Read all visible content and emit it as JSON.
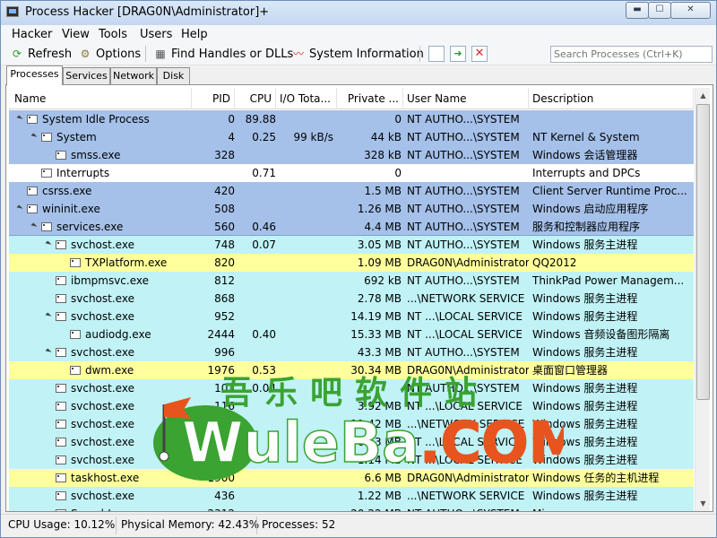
{
  "window": {
    "title": "Process Hacker [DRAG0N\\Administrator]+",
    "controls": {
      "minimize": "▬",
      "maximize": "☐",
      "close": "✕"
    }
  },
  "menu": [
    "Hacker",
    "View",
    "Tools",
    "Users",
    "Help"
  ],
  "toolbar": {
    "refresh": "Refresh",
    "options": "Options",
    "find_handles": "Find Handles or DLLs",
    "system_info": "System Information",
    "search_placeholder": "Search Processes (Ctrl+K)"
  },
  "tabs": [
    "Processes",
    "Services",
    "Network",
    "Disk"
  ],
  "columns": [
    "Name",
    "PID",
    "CPU",
    "I/O Tota...",
    "Private ...",
    "User Name",
    "Description"
  ],
  "rows": [
    {
      "name": "System Idle Process",
      "pid": "0",
      "cpu": "89.88",
      "io": "",
      "priv": "0",
      "user": "NT AUTHO...\\SYSTEM",
      "desc": "",
      "color": "#a5c1ea",
      "depth": 0,
      "exp": true
    },
    {
      "name": "System",
      "pid": "4",
      "cpu": "0.25",
      "io": "99 kB/s",
      "priv": "44 kB",
      "user": "NT AUTHO...\\SYSTEM",
      "desc": "NT Kernel & System",
      "color": "#a5c1ea",
      "depth": 1,
      "exp": true
    },
    {
      "name": "smss.exe",
      "pid": "328",
      "cpu": "",
      "io": "",
      "priv": "328 kB",
      "user": "NT AUTHO...\\SYSTEM",
      "desc": "Windows 会话管理器",
      "color": "#a5c1ea",
      "depth": 2,
      "exp": false
    },
    {
      "name": "Interrupts",
      "pid": "",
      "cpu": "0.71",
      "io": "",
      "priv": "0",
      "user": "",
      "desc": "Interrupts and DPCs",
      "color": "#ffffff",
      "depth": 1,
      "exp": false
    },
    {
      "name": "csrss.exe",
      "pid": "420",
      "cpu": "",
      "io": "",
      "priv": "1.5 MB",
      "user": "NT AUTHO...\\SYSTEM",
      "desc": "Client Server Runtime Proc...",
      "color": "#a5c1ea",
      "depth": 0,
      "exp": false
    },
    {
      "name": "wininit.exe",
      "pid": "508",
      "cpu": "",
      "io": "",
      "priv": "1.26 MB",
      "user": "NT AUTHO...\\SYSTEM",
      "desc": "Windows 启动应用程序",
      "color": "#a5c1ea",
      "depth": 0,
      "exp": true
    },
    {
      "name": "services.exe",
      "pid": "560",
      "cpu": "0.46",
      "io": "",
      "priv": "4.4 MB",
      "user": "NT AUTHO...\\SYSTEM",
      "desc": "服务和控制器应用程序",
      "color": "#a5c1ea",
      "depth": 1,
      "exp": true
    },
    {
      "name": "svchost.exe",
      "pid": "748",
      "cpu": "0.07",
      "io": "",
      "priv": "3.05 MB",
      "user": "NT AUTHO...\\SYSTEM",
      "desc": "Windows 服务主进程",
      "color": "#c0f2f6",
      "depth": 2,
      "exp": true,
      "selected": true
    },
    {
      "name": "TXPlatform.exe",
      "pid": "820",
      "cpu": "",
      "io": "",
      "priv": "1.09 MB",
      "user": "DRAG0N\\Administrator",
      "desc": "QQ2012",
      "color": "#ffff9c",
      "depth": 3,
      "exp": false
    },
    {
      "name": "ibmpmsvc.exe",
      "pid": "812",
      "cpu": "",
      "io": "",
      "priv": "692 kB",
      "user": "NT AUTHO...\\SYSTEM",
      "desc": "ThinkPad Power Managem...",
      "color": "#c0f2f6",
      "depth": 2,
      "exp": false
    },
    {
      "name": "svchost.exe",
      "pid": "868",
      "cpu": "",
      "io": "",
      "priv": "2.78 MB",
      "user": "...\\NETWORK SERVICE",
      "desc": "Windows 服务主进程",
      "color": "#c0f2f6",
      "depth": 2,
      "exp": false
    },
    {
      "name": "svchost.exe",
      "pid": "952",
      "cpu": "",
      "io": "",
      "priv": "14.19 MB",
      "user": "NT ...\\LOCAL SERVICE",
      "desc": "Windows 服务主进程",
      "color": "#c0f2f6",
      "depth": 2,
      "exp": true
    },
    {
      "name": "audiodg.exe",
      "pid": "2444",
      "cpu": "0.40",
      "io": "",
      "priv": "15.33 MB",
      "user": "NT ...\\LOCAL SERVICE",
      "desc": "Windows 音频设备图形隔离",
      "color": "#c0f2f6",
      "depth": 3,
      "exp": false
    },
    {
      "name": "svchost.exe",
      "pid": "996",
      "cpu": "",
      "io": "",
      "priv": "43.3 MB",
      "user": "NT AUTHO...\\SYSTEM",
      "desc": "Windows 服务主进程",
      "color": "#c0f2f6",
      "depth": 2,
      "exp": true
    },
    {
      "name": "dwm.exe",
      "pid": "1976",
      "cpu": "0.53",
      "io": "",
      "priv": "30.34 MB",
      "user": "DRAG0N\\Administrator",
      "desc": "桌面窗口管理器",
      "color": "#ffff9c",
      "depth": 3,
      "exp": false
    },
    {
      "name": "svchost.exe",
      "pid": "103",
      "cpu": "0.04",
      "io": "",
      "priv": "",
      "user": "NT AUTHO...\\SYSTEM",
      "desc": "Windows 服务主进程",
      "color": "#c0f2f6",
      "depth": 2,
      "exp": false
    },
    {
      "name": "svchost.exe",
      "pid": "116",
      "cpu": "",
      "io": "",
      "priv": "3.92 MB",
      "user": "NT ...\\LOCAL SERVICE",
      "desc": "Windows 服务主进程",
      "color": "#c0f2f6",
      "depth": 2,
      "exp": false
    },
    {
      "name": "svchost.exe",
      "pid": "",
      "cpu": "",
      "io": "",
      "priv": "11.42 MB",
      "user": "...\\NETWORK SERVICE",
      "desc": "Windows 服务主进程",
      "color": "#c0f2f6",
      "depth": 2,
      "exp": false
    },
    {
      "name": "svchost.exe",
      "pid": "",
      "cpu": "",
      "io": "",
      "priv": "6.13 MB",
      "user": "NT ...\\LOCAL SERVICE",
      "desc": "Windows 服务主进程",
      "color": "#c0f2f6",
      "depth": 2,
      "exp": false
    },
    {
      "name": "svchost.exe",
      "pid": "",
      "cpu": "",
      "io": "",
      "priv": "1.14 MB",
      "user": "NT ...\\LOCAL SERVICE",
      "desc": "Windows 服务主进程",
      "color": "#c0f2f6",
      "depth": 2,
      "exp": false
    },
    {
      "name": "taskhost.exe",
      "pid": "1900",
      "cpu": "",
      "io": "",
      "priv": "6.6 MB",
      "user": "DRAG0N\\Administrator",
      "desc": "Windows 任务的主机进程",
      "color": "#ffff9c",
      "depth": 2,
      "exp": false
    },
    {
      "name": "svchost.exe",
      "pid": "436",
      "cpu": "",
      "io": "",
      "priv": "1.22 MB",
      "user": "...\\NETWORK SERVICE",
      "desc": "Windows 服务主进程",
      "color": "#c0f2f6",
      "depth": 2,
      "exp": false
    },
    {
      "name": "SearchI...",
      "pid": "2312",
      "cpu": "",
      "io": "",
      "priv": "20.22 MB",
      "user": "NT AUTHO...\\SYSTEM",
      "desc": "Mi...",
      "color": "#c0f2f6",
      "depth": 2,
      "exp": false
    }
  ],
  "status": {
    "cpu": "CPU Usage: 10.12%",
    "memory": "Physical Memory: 42.43%",
    "processes": "Processes: 52"
  },
  "watermark": {
    "chars": "吾乐吧软件站",
    "logo": "WuleBa.COM"
  }
}
